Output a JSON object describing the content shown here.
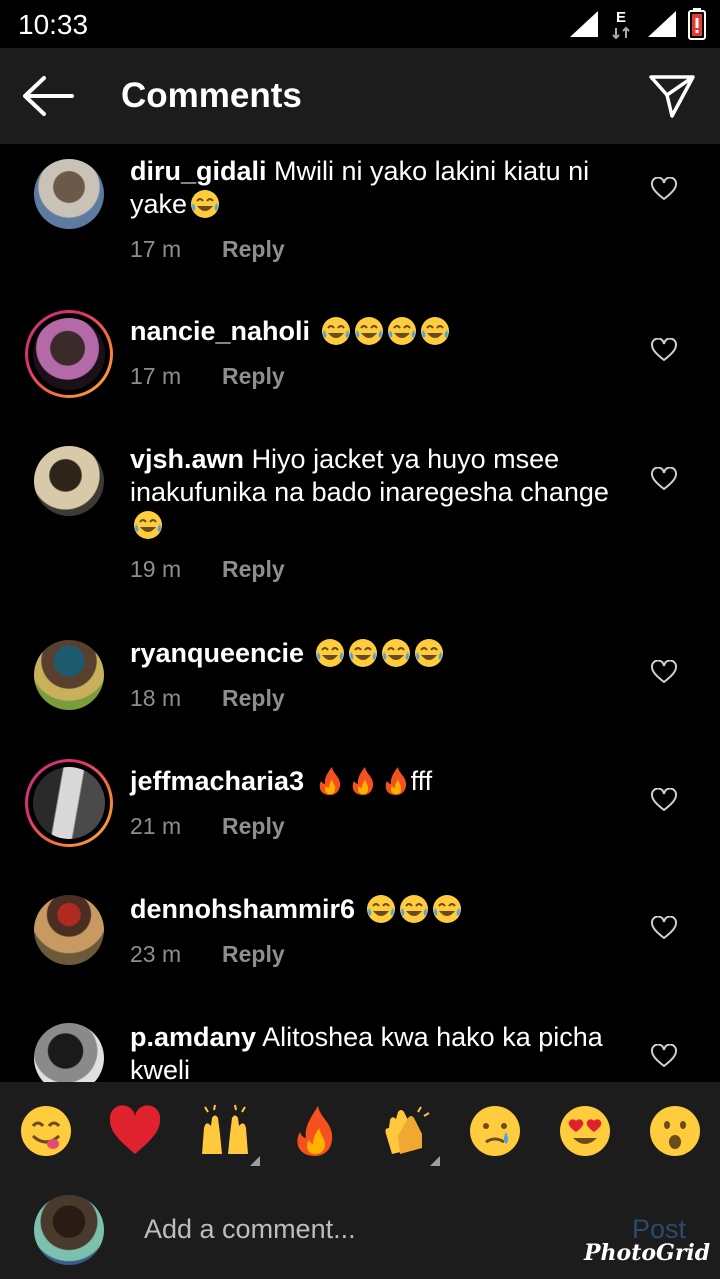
{
  "status_bar": {
    "time": "10:33",
    "network": "E"
  },
  "header": {
    "title": "Comments"
  },
  "comments": [
    {
      "user": "diru_gidali",
      "text": "Mwili ni yako lakini kiatu ni yake",
      "emojis": [
        "laughing-tears"
      ],
      "time": "17 m",
      "reply": "Reply",
      "story_ring": false
    },
    {
      "user": "nancie_naholi",
      "text": "",
      "emojis": [
        "laughing-tears",
        "laughing-tears",
        "laughing-tears",
        "laughing-tears"
      ],
      "time": "17 m",
      "reply": "Reply",
      "story_ring": true
    },
    {
      "user": "vjsh.awn",
      "text": "Hiyo jacket ya huyo msee inakufunika na bado inaregesha change",
      "emojis": [
        "laughing-tears"
      ],
      "time": "19 m",
      "reply": "Reply",
      "story_ring": false
    },
    {
      "user": "ryanqueencie",
      "text": "",
      "emojis": [
        "laughing-tears",
        "laughing-tears",
        "laughing-tears",
        "laughing-tears"
      ],
      "time": "18 m",
      "reply": "Reply",
      "story_ring": false
    },
    {
      "user": "jeffmacharia3",
      "text": "",
      "emojis": [
        "fire",
        "fire",
        "fire"
      ],
      "text_after": "fff",
      "time": "21 m",
      "reply": "Reply",
      "story_ring": true
    },
    {
      "user": "dennohshammir6",
      "text": "",
      "emojis": [
        "laughing-tears",
        "laughing-tears",
        "laughing-tears"
      ],
      "time": "23 m",
      "reply": "Reply",
      "story_ring": false
    },
    {
      "user": "p.amdany",
      "text": "Alitoshea kwa hako ka picha kweli",
      "emojis": [],
      "time": "",
      "reply": "",
      "story_ring": false
    }
  ],
  "quick_emojis": [
    "yum-face",
    "red-heart",
    "raised-hands",
    "fire",
    "clapping-hands",
    "crying-face",
    "heart-eyes",
    "surprised-face"
  ],
  "composer": {
    "placeholder": "Add a comment...",
    "post_label": "Post"
  },
  "watermark": "PhotoGrid",
  "colors": {
    "background": "#000000",
    "bar": "#1c1c1c",
    "meta": "#8e8e8e",
    "post_disabled": "#2a4a6e"
  }
}
